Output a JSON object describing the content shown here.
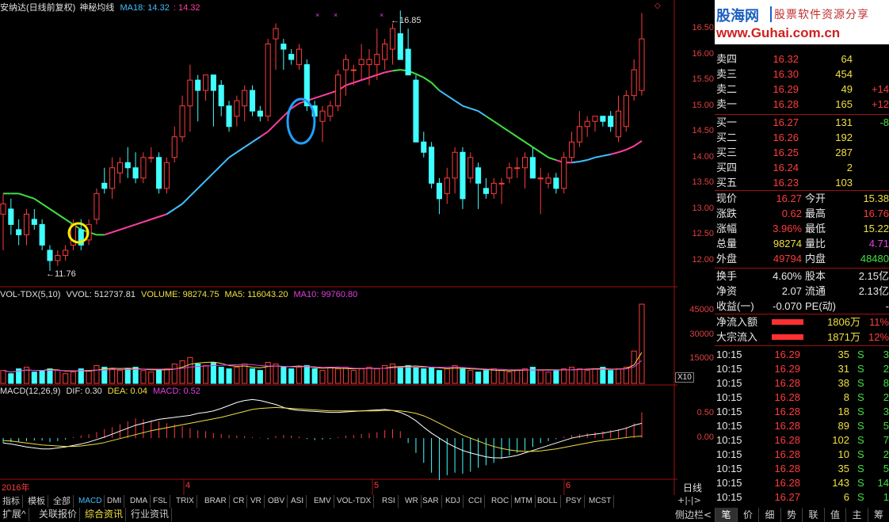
{
  "header": {
    "stock_name": "安纳达(日线前复权)",
    "indicator_name": "神秘均线",
    "ma18_label": "MA18: 14.32",
    "ma18_value2": ": 14.32",
    "high_label": "16.85",
    "low_label": "11.76"
  },
  "price_axis": [
    "16.50",
    "16.00",
    "15.50",
    "15.00",
    "14.50",
    "14.00",
    "13.50",
    "13.00",
    "12.50",
    "12.00"
  ],
  "vol_header": {
    "name": "VOL-TDX(5,10)",
    "vvol": "VVOL: 512737.81",
    "volume": "VOLUME: 98274.75",
    "ma5": "MA5: 116043.20",
    "ma10": "MA10: 99760.80"
  },
  "vol_axis": [
    "45000",
    "30000",
    "15000"
  ],
  "vol_unit": "X10",
  "macd_header": {
    "name": "MACD(12,26,9)",
    "dif": "DIF: 0.30",
    "dea": "DEA: 0.04",
    "macd": "MACD: 0.52"
  },
  "macd_axis": [
    "0.50",
    "0.00"
  ],
  "date_axis": [
    "2016年",
    "4",
    "5",
    "6"
  ],
  "period_label": "日线",
  "logo": {
    "title": "股海网",
    "subtitle": "股票软件资源分享",
    "url": "www.Guhai.com.cn"
  },
  "order_book": {
    "asks": [
      {
        "label": "卖四",
        "price": "16.32",
        "vol": "64",
        "chg": ""
      },
      {
        "label": "卖三",
        "price": "16.30",
        "vol": "454",
        "chg": ""
      },
      {
        "label": "卖二",
        "price": "16.29",
        "vol": "49",
        "chg": "+14"
      },
      {
        "label": "卖一",
        "price": "16.28",
        "vol": "165",
        "chg": "+12"
      }
    ],
    "bids": [
      {
        "label": "买一",
        "price": "16.27",
        "vol": "131",
        "chg": "-8"
      },
      {
        "label": "买二",
        "price": "16.26",
        "vol": "192",
        "chg": ""
      },
      {
        "label": "买三",
        "price": "16.25",
        "vol": "287",
        "chg": ""
      },
      {
        "label": "买四",
        "price": "16.24",
        "vol": "2",
        "chg": ""
      },
      {
        "label": "买五",
        "price": "16.23",
        "vol": "103",
        "chg": ""
      }
    ]
  },
  "quote": [
    {
      "l1": "现价",
      "v1": "16.27",
      "l2": "今开",
      "v2": "15.38"
    },
    {
      "l1": "涨跌",
      "v1": "0.62",
      "l2": "最高",
      "v2": "16.76"
    },
    {
      "l1": "涨幅",
      "v1": "3.96%",
      "l2": "最低",
      "v2": "15.22"
    },
    {
      "l1": "总量",
      "v1": "98274",
      "l2": "量比",
      "v2": "4.71"
    },
    {
      "l1": "外盘",
      "v1": "49794",
      "l2": "内盘",
      "v2": "48480"
    }
  ],
  "finance": [
    {
      "l1": "换手",
      "v1": "4.60%",
      "l2": "股本",
      "v2": "2.15亿"
    },
    {
      "l1": "净资",
      "v1": "2.07",
      "l2": "流通",
      "v2": "2.13亿"
    },
    {
      "l1": "收益(一)",
      "v1": "-0.070",
      "l2": "PE(动)",
      "v2": "-"
    }
  ],
  "flows": [
    {
      "label": "净流入额",
      "value": "1806万",
      "pct": "11%"
    },
    {
      "label": "大宗流入",
      "value": "1871万",
      "pct": "12%"
    }
  ],
  "ticks": [
    {
      "t": "10:15",
      "p": "16.29",
      "v": "35",
      "s": "S",
      "n": "3"
    },
    {
      "t": "10:15",
      "p": "16.29",
      "v": "31",
      "s": "S",
      "n": "2"
    },
    {
      "t": "10:15",
      "p": "16.28",
      "v": "38",
      "s": "S",
      "n": "8"
    },
    {
      "t": "10:15",
      "p": "16.28",
      "v": "8",
      "s": "S",
      "n": "2"
    },
    {
      "t": "10:15",
      "p": "16.28",
      "v": "18",
      "s": "S",
      "n": "3"
    },
    {
      "t": "10:15",
      "p": "16.28",
      "v": "89",
      "s": "S",
      "n": "5"
    },
    {
      "t": "10:15",
      "p": "16.28",
      "v": "102",
      "s": "S",
      "n": "7"
    },
    {
      "t": "10:15",
      "p": "16.28",
      "v": "10",
      "s": "S",
      "n": "2"
    },
    {
      "t": "10:15",
      "p": "16.28",
      "v": "35",
      "s": "S",
      "n": "5"
    },
    {
      "t": "10:15",
      "p": "16.28",
      "v": "143",
      "s": "S",
      "n": "14"
    },
    {
      "t": "10:15",
      "p": "16.27",
      "v": "6",
      "s": "S",
      "n": "1"
    }
  ],
  "indicator_tabs": [
    "指标",
    "模板",
    "全部",
    "MACD",
    "DMI",
    "DMA",
    "FSL",
    "TRIX",
    "BRAR",
    "CR",
    "VR",
    "OBV",
    "ASI",
    "EMV",
    "VOL-TDX",
    "RSI",
    "WR",
    "SAR",
    "KDJ",
    "CCI",
    "ROC",
    "MTM",
    "BOLL",
    "PSY",
    "MCST"
  ],
  "bottom_tabs": [
    "扩展^",
    "关联报价",
    "综合资讯",
    "行业资讯"
  ],
  "side_label": "侧边栏<",
  "right_tabs": [
    "笔",
    "价",
    "细",
    "势",
    "联",
    "值",
    "主",
    "筹"
  ],
  "colors": {
    "up": "#ff3c3c",
    "down": "#40ffff",
    "ma_green": "#40e040",
    "ma_cyan": "#40c0ff",
    "ma_pink": "#ff40a0",
    "grid": "#800000"
  },
  "chart_data": {
    "type": "candlestick",
    "price_range": [
      11.6,
      16.9
    ],
    "candles": [
      {
        "o": 12.9,
        "h": 13.3,
        "l": 12.2,
        "c": 13.1
      },
      {
        "o": 13.0,
        "h": 13.2,
        "l": 12.5,
        "c": 12.7
      },
      {
        "o": 12.6,
        "h": 12.8,
        "l": 12.3,
        "c": 12.5
      },
      {
        "o": 12.5,
        "h": 13.0,
        "l": 12.3,
        "c": 12.9
      },
      {
        "o": 12.8,
        "h": 13.0,
        "l": 12.6,
        "c": 12.7
      },
      {
        "o": 12.7,
        "h": 12.8,
        "l": 12.2,
        "c": 12.3
      },
      {
        "o": 12.2,
        "h": 12.3,
        "l": 11.8,
        "c": 12.0
      },
      {
        "o": 12.0,
        "h": 12.2,
        "l": 11.9,
        "c": 12.1
      },
      {
        "o": 12.1,
        "h": 12.3,
        "l": 12.0,
        "c": 12.2
      },
      {
        "o": 12.3,
        "h": 12.8,
        "l": 12.2,
        "c": 12.7
      },
      {
        "o": 12.6,
        "h": 12.8,
        "l": 12.2,
        "c": 12.3
      },
      {
        "o": 12.4,
        "h": 12.8,
        "l": 12.3,
        "c": 12.7
      },
      {
        "o": 12.8,
        "h": 13.4,
        "l": 12.7,
        "c": 13.3
      },
      {
        "o": 13.5,
        "h": 13.8,
        "l": 13.3,
        "c": 13.4
      },
      {
        "o": 13.4,
        "h": 14.0,
        "l": 13.2,
        "c": 13.8
      },
      {
        "o": 13.7,
        "h": 14.0,
        "l": 13.5,
        "c": 13.9
      },
      {
        "o": 13.9,
        "h": 14.2,
        "l": 13.6,
        "c": 13.8
      },
      {
        "o": 13.8,
        "h": 14.1,
        "l": 13.5,
        "c": 13.6
      },
      {
        "o": 13.6,
        "h": 14.1,
        "l": 13.5,
        "c": 14.0
      },
      {
        "o": 14.0,
        "h": 14.2,
        "l": 13.9,
        "c": 14.0
      },
      {
        "o": 14.0,
        "h": 14.1,
        "l": 13.3,
        "c": 13.4
      },
      {
        "o": 13.4,
        "h": 14.0,
        "l": 13.3,
        "c": 13.9
      },
      {
        "o": 14.0,
        "h": 14.6,
        "l": 13.9,
        "c": 14.4
      },
      {
        "o": 14.4,
        "h": 15.2,
        "l": 14.3,
        "c": 15.0
      },
      {
        "o": 15.0,
        "h": 15.8,
        "l": 14.5,
        "c": 15.5
      },
      {
        "o": 15.5,
        "h": 15.6,
        "l": 14.7,
        "c": 15.3
      },
      {
        "o": 15.3,
        "h": 15.6,
        "l": 15.1,
        "c": 15.6
      },
      {
        "o": 15.6,
        "h": 15.6,
        "l": 14.6,
        "c": 15.3
      },
      {
        "o": 15.4,
        "h": 15.5,
        "l": 14.8,
        "c": 15.0
      },
      {
        "o": 15.0,
        "h": 15.1,
        "l": 14.5,
        "c": 14.6
      },
      {
        "o": 14.8,
        "h": 15.2,
        "l": 14.6,
        "c": 15.1
      },
      {
        "o": 15.0,
        "h": 15.4,
        "l": 14.7,
        "c": 15.3
      },
      {
        "o": 15.3,
        "h": 15.4,
        "l": 14.8,
        "c": 14.9
      },
      {
        "o": 14.9,
        "h": 15.0,
        "l": 14.7,
        "c": 14.8
      },
      {
        "o": 14.8,
        "h": 16.3,
        "l": 14.7,
        "c": 16.2
      },
      {
        "o": 16.3,
        "h": 16.6,
        "l": 15.7,
        "c": 16.5
      },
      {
        "o": 16.2,
        "h": 16.3,
        "l": 15.7,
        "c": 16.1
      },
      {
        "o": 16.0,
        "h": 16.1,
        "l": 15.8,
        "c": 15.9
      },
      {
        "o": 15.8,
        "h": 16.2,
        "l": 15.7,
        "c": 16.1
      },
      {
        "o": 15.8,
        "h": 15.9,
        "l": 14.9,
        "c": 15.0
      },
      {
        "o": 15.0,
        "h": 15.1,
        "l": 14.8,
        "c": 14.8
      },
      {
        "o": 14.7,
        "h": 15.0,
        "l": 14.3,
        "c": 14.9
      },
      {
        "o": 14.8,
        "h": 15.1,
        "l": 14.7,
        "c": 15.0
      },
      {
        "o": 15.0,
        "h": 15.7,
        "l": 14.9,
        "c": 15.6
      },
      {
        "o": 15.7,
        "h": 16.0,
        "l": 15.2,
        "c": 15.9
      },
      {
        "o": 15.7,
        "h": 15.8,
        "l": 15.4,
        "c": 15.7
      },
      {
        "o": 15.8,
        "h": 16.2,
        "l": 15.5,
        "c": 15.9
      },
      {
        "o": 15.8,
        "h": 16.1,
        "l": 15.4,
        "c": 15.9
      },
      {
        "o": 15.8,
        "h": 16.5,
        "l": 15.5,
        "c": 16.0
      },
      {
        "o": 15.9,
        "h": 16.3,
        "l": 15.7,
        "c": 16.2
      },
      {
        "o": 16.1,
        "h": 16.6,
        "l": 15.8,
        "c": 16.5
      },
      {
        "o": 16.4,
        "h": 16.85,
        "l": 15.9,
        "c": 15.9
      },
      {
        "o": 16.1,
        "h": 16.5,
        "l": 15.6,
        "c": 15.6
      },
      {
        "o": 15.5,
        "h": 15.6,
        "l": 14.3,
        "c": 14.3
      },
      {
        "o": 14.3,
        "h": 14.5,
        "l": 14.0,
        "c": 14.1
      },
      {
        "o": 14.2,
        "h": 14.3,
        "l": 13.4,
        "c": 13.5
      },
      {
        "o": 13.5,
        "h": 13.6,
        "l": 12.9,
        "c": 13.2
      },
      {
        "o": 13.3,
        "h": 13.8,
        "l": 13.1,
        "c": 13.6
      },
      {
        "o": 13.6,
        "h": 14.2,
        "l": 13.3,
        "c": 14.1
      },
      {
        "o": 14.1,
        "h": 14.2,
        "l": 13.0,
        "c": 13.2
      },
      {
        "o": 13.6,
        "h": 14.1,
        "l": 13.5,
        "c": 14.0
      },
      {
        "o": 13.8,
        "h": 13.9,
        "l": 13.0,
        "c": 13.5
      },
      {
        "o": 13.4,
        "h": 13.6,
        "l": 13.2,
        "c": 13.3
      },
      {
        "o": 13.3,
        "h": 13.6,
        "l": 13.2,
        "c": 13.5
      },
      {
        "o": 13.5,
        "h": 13.6,
        "l": 13.1,
        "c": 13.5
      },
      {
        "o": 13.6,
        "h": 13.9,
        "l": 13.5,
        "c": 13.8
      },
      {
        "o": 13.8,
        "h": 14.0,
        "l": 13.6,
        "c": 13.8
      },
      {
        "o": 13.8,
        "h": 14.1,
        "l": 13.4,
        "c": 14.0
      },
      {
        "o": 14.0,
        "h": 14.2,
        "l": 13.6,
        "c": 13.6
      },
      {
        "o": 13.6,
        "h": 13.8,
        "l": 12.9,
        "c": 13.6
      },
      {
        "o": 13.5,
        "h": 13.7,
        "l": 13.4,
        "c": 13.6
      },
      {
        "o": 13.6,
        "h": 13.7,
        "l": 13.3,
        "c": 13.4
      },
      {
        "o": 13.4,
        "h": 14.1,
        "l": 13.3,
        "c": 14.0
      },
      {
        "o": 14.0,
        "h": 14.5,
        "l": 13.9,
        "c": 14.3
      },
      {
        "o": 14.3,
        "h": 14.9,
        "l": 14.2,
        "c": 14.6
      },
      {
        "o": 14.6,
        "h": 14.8,
        "l": 14.4,
        "c": 14.7
      },
      {
        "o": 14.7,
        "h": 14.8,
        "l": 14.5,
        "c": 14.8
      },
      {
        "o": 14.8,
        "h": 14.8,
        "l": 14.6,
        "c": 14.7
      },
      {
        "o": 14.8,
        "h": 14.9,
        "l": 14.5,
        "c": 14.6
      },
      {
        "o": 14.4,
        "h": 15.2,
        "l": 14.3,
        "c": 14.9
      },
      {
        "o": 14.6,
        "h": 15.3,
        "l": 14.5,
        "c": 15.2
      },
      {
        "o": 15.2,
        "h": 15.9,
        "l": 15.1,
        "c": 15.7
      },
      {
        "o": 15.3,
        "h": 16.8,
        "l": 15.2,
        "c": 16.3
      }
    ],
    "ma": [
      13.3,
      13.3,
      13.3,
      13.25,
      13.2,
      13.1,
      13.0,
      12.9,
      12.8,
      12.7,
      12.6,
      12.55,
      12.5,
      12.5,
      12.55,
      12.6,
      12.65,
      12.7,
      12.75,
      12.8,
      12.85,
      12.9,
      13.0,
      13.1,
      13.25,
      13.4,
      13.55,
      13.7,
      13.85,
      14.0,
      14.1,
      14.2,
      14.3,
      14.4,
      14.5,
      14.65,
      14.8,
      14.95,
      15.05,
      15.1,
      15.15,
      15.2,
      15.25,
      15.3,
      15.4,
      15.45,
      15.5,
      15.55,
      15.6,
      15.65,
      15.68,
      15.7,
      15.68,
      15.62,
      15.55,
      15.45,
      15.3,
      15.2,
      15.1,
      15.0,
      14.95,
      14.9,
      14.8,
      14.7,
      14.6,
      14.5,
      14.4,
      14.3,
      14.2,
      14.1,
      14.0,
      13.95,
      13.9,
      13.9,
      13.92,
      13.95,
      14.0,
      14.03,
      14.06,
      14.1,
      14.15,
      14.22,
      14.32
    ],
    "volume": [
      8,
      6,
      9,
      10,
      7,
      8,
      9,
      8,
      6,
      7,
      9,
      8,
      11,
      10,
      9,
      8,
      9,
      10,
      8,
      7,
      8,
      9,
      12,
      14,
      16,
      12,
      11,
      13,
      10,
      9,
      10,
      12,
      9,
      8,
      13,
      12,
      10,
      9,
      10,
      11,
      9,
      8,
      10,
      9,
      10,
      8,
      9,
      10,
      9,
      11,
      12,
      10,
      11,
      10,
      9,
      10,
      8,
      9,
      11,
      9,
      8,
      7,
      8,
      9,
      8,
      7,
      8,
      9,
      10,
      8,
      7,
      8,
      9,
      10,
      9,
      8,
      9,
      10,
      8,
      9,
      10,
      20,
      49
    ],
    "macd_hist": [
      -0.1,
      -0.08,
      -0.07,
      -0.06,
      -0.05,
      -0.05,
      -0.08,
      -0.06,
      -0.03,
      0.02,
      0.05,
      0.08,
      0.12,
      0.18,
      0.22,
      0.28,
      0.34,
      0.4,
      0.38,
      0.36,
      0.34,
      0.3,
      0.28,
      0.24,
      0.2,
      0.16,
      0.14,
      0.1,
      0.08,
      0.06,
      0.05,
      0.04,
      0.02,
      0.01,
      -0.02,
      0.04,
      0.06,
      0.05,
      0.03,
      -0.02,
      -0.04,
      -0.03,
      -0.02,
      0.02,
      0.05,
      0.06,
      0.08,
      0.1,
      0.12,
      0.16,
      0.18,
      0.14,
      -0.1,
      -0.3,
      -0.5,
      -0.7,
      -0.85,
      -0.75,
      -0.7,
      -0.72,
      -0.68,
      -0.6,
      -0.55,
      -0.5,
      -0.42,
      -0.35,
      -0.3,
      -0.25,
      -0.18,
      -0.1,
      -0.06,
      -0.02,
      0.03,
      0.06,
      0.08,
      0.1,
      0.12,
      0.14,
      0.16,
      0.18,
      0.22,
      0.3,
      0.52
    ],
    "dif": [
      -0.1,
      -0.12,
      -0.15,
      -0.18,
      -0.2,
      -0.22,
      -0.22,
      -0.2,
      -0.18,
      -0.15,
      -0.12,
      -0.08,
      -0.03,
      0.02,
      0.08,
      0.14,
      0.2,
      0.26,
      0.3,
      0.34,
      0.38,
      0.4,
      0.42,
      0.44,
      0.46,
      0.5,
      0.52,
      0.55,
      0.6,
      0.66,
      0.72,
      0.76,
      0.78,
      0.76,
      0.72,
      0.68,
      0.62,
      0.58,
      0.56,
      0.55,
      0.54,
      0.53,
      0.52,
      0.52,
      0.53,
      0.54,
      0.55,
      0.56,
      0.57,
      0.58,
      0.56,
      0.52,
      0.45,
      0.35,
      0.22,
      0.1,
      0.0,
      -0.1,
      -0.18,
      -0.25,
      -0.3,
      -0.34,
      -0.38,
      -0.4,
      -0.4,
      -0.38,
      -0.35,
      -0.3,
      -0.25,
      -0.2,
      -0.15,
      -0.1,
      -0.05,
      0.0,
      0.03,
      0.06,
      0.08,
      0.1,
      0.13,
      0.16,
      0.2,
      0.26,
      0.3
    ],
    "dea": [
      -0.05,
      -0.06,
      -0.08,
      -0.1,
      -0.12,
      -0.14,
      -0.15,
      -0.16,
      -0.17,
      -0.17,
      -0.16,
      -0.14,
      -0.12,
      -0.09,
      -0.05,
      -0.01,
      0.03,
      0.07,
      0.11,
      0.15,
      0.18,
      0.21,
      0.24,
      0.27,
      0.3,
      0.33,
      0.36,
      0.39,
      0.42,
      0.46,
      0.5,
      0.54,
      0.58,
      0.6,
      0.61,
      0.62,
      0.61,
      0.6,
      0.59,
      0.58,
      0.57,
      0.56,
      0.55,
      0.55,
      0.55,
      0.55,
      0.55,
      0.55,
      0.55,
      0.56,
      0.56,
      0.55,
      0.53,
      0.5,
      0.45,
      0.38,
      0.3,
      0.22,
      0.14,
      0.06,
      0.0,
      -0.06,
      -0.12,
      -0.17,
      -0.21,
      -0.24,
      -0.26,
      -0.27,
      -0.27,
      -0.26,
      -0.24,
      -0.22,
      -0.19,
      -0.16,
      -0.13,
      -0.1,
      -0.07,
      -0.05,
      -0.03,
      -0.01,
      0.01,
      0.03,
      0.04
    ],
    "vol_range": [
      0,
      50
    ],
    "macd_range": [
      -0.8,
      0.85
    ]
  }
}
